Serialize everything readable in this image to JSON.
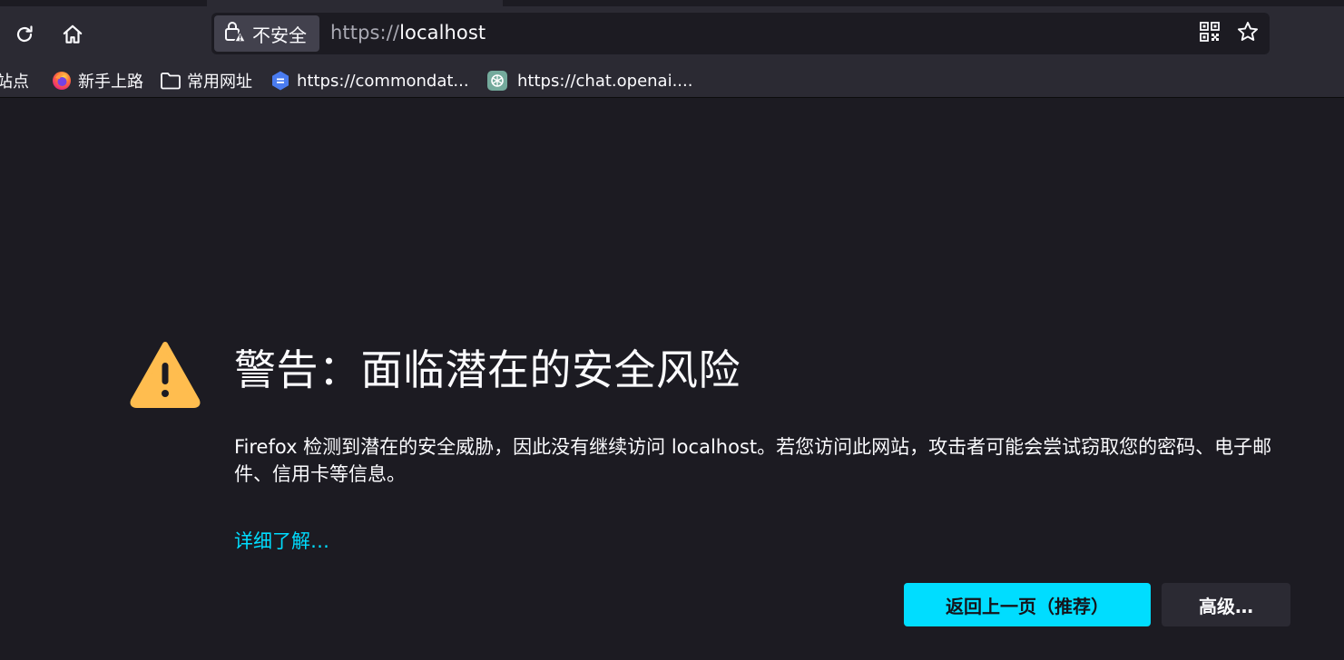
{
  "toolbar": {
    "reload_icon": "reload-icon",
    "home_icon": "home-icon"
  },
  "urlbar": {
    "security_label": "不安全",
    "url_scheme": "https://",
    "url_host": "localhost",
    "qr_icon": "qr-code-icon",
    "bookmark_icon": "star-icon"
  },
  "bookmarks": {
    "items": [
      {
        "label": "访站点",
        "icon": "none"
      },
      {
        "label": "新手上路",
        "icon": "firefox-icon"
      },
      {
        "label": "常用网址",
        "icon": "folder-icon"
      },
      {
        "label": "https://commondat...",
        "icon": "doc-icon"
      },
      {
        "label": "https://chat.openai....",
        "icon": "openai-icon"
      }
    ]
  },
  "error": {
    "title": "警告：面临潜在的安全风险",
    "description": "Firefox 检测到潜在的安全威胁，因此没有继续访问 localhost。若您访问此网站，攻击者可能会尝试窃取您的密码、电子邮件、信用卡等信息。",
    "learn_more": "详细了解…",
    "go_back_button": "返回上一页（推荐）",
    "advanced_button": "高级…"
  },
  "colors": {
    "page_bg": "#1c1b22",
    "toolbar_bg": "#2b2a33",
    "accent": "#00ddff",
    "warning": "#ffbd4f",
    "text": "#fbfbfe"
  }
}
